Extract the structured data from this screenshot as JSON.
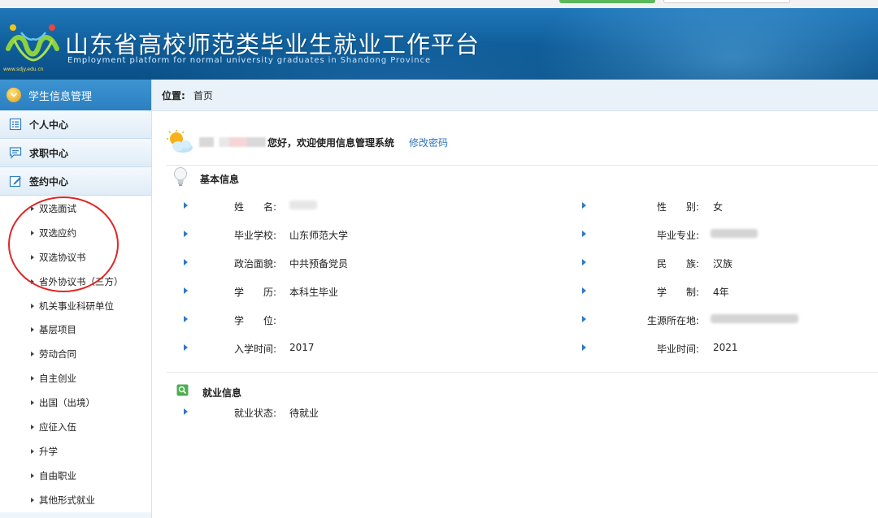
{
  "header": {
    "title": "山东省高校师范类毕业生就业工作平台",
    "subtitle": "Employment platform for normal university graduates in Shandong Province",
    "logo_url": "www.sdjy.edu.cn"
  },
  "sidebar": {
    "top_label": "学生信息管理",
    "menus": [
      {
        "label": "个人中心",
        "icon": "list-icon"
      },
      {
        "label": "求职中心",
        "icon": "chat-icon"
      },
      {
        "label": "签约中心",
        "icon": "edit-icon"
      }
    ],
    "sub_items": [
      "双选面试",
      "双选应约",
      "双选协议书",
      "省外协议书（三方）",
      "机关事业科研单位",
      "基层项目",
      "劳动合同",
      "自主创业",
      "出国（出境）",
      "应征入伍",
      "升学",
      "自由职业",
      "其他形式就业"
    ]
  },
  "breadcrumb": {
    "label": "位置:",
    "value": "首页"
  },
  "welcome": {
    "text": "您好，欢迎使用信息管理系统",
    "change_password": "修改密码"
  },
  "basic_info": {
    "title": "基本信息",
    "left": [
      {
        "label": "姓　　名:",
        "value": ""
      },
      {
        "label": "毕业学校:",
        "value": "山东师范大学"
      },
      {
        "label": "政治面貌:",
        "value": "中共预备党员"
      },
      {
        "label": "学　　历:",
        "value": "本科生毕业"
      },
      {
        "label": "学　　位:",
        "value": ""
      },
      {
        "label": "入学时间:",
        "value": "2017"
      }
    ],
    "right": [
      {
        "label": "性　　别:",
        "value": "女"
      },
      {
        "label": "毕业专业:",
        "value": ""
      },
      {
        "label": "民　　族:",
        "value": "汉族"
      },
      {
        "label": "学　　制:",
        "value": "4年"
      },
      {
        "label": "生源所在地:",
        "value": ""
      },
      {
        "label": "毕业时间:",
        "value": "2021"
      }
    ]
  },
  "employment_info": {
    "title": "就业信息",
    "rows": [
      {
        "label": "就业状态:",
        "value": "待就业"
      }
    ]
  },
  "colors": {
    "header": "#0f5d99",
    "link": "#2d74c3",
    "annotation": "#e02626"
  }
}
